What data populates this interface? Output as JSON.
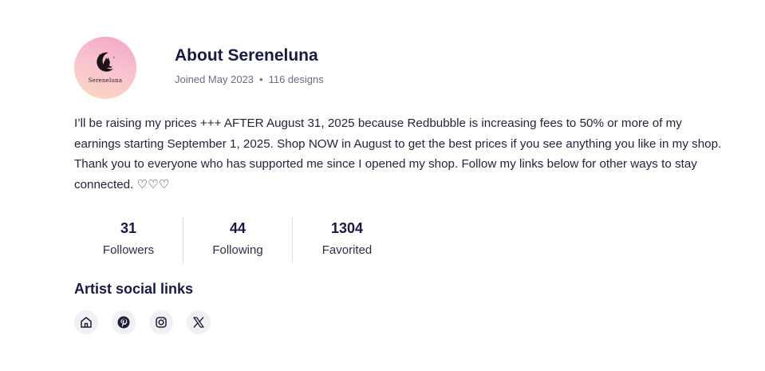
{
  "profile": {
    "avatar_text": "Sereneluna",
    "title": "About Sereneluna",
    "joined": "Joined May 2023",
    "separator": "•",
    "designs": "116 designs",
    "bio": "I’ll be raising my prices +++ AFTER August 31, 2025 because Redbubble is increasing fees to 50% or more of my earnings starting September 1, 2025. Shop NOW in August to get the best prices if you see anything you like in my shop. Thank you to everyone who has supported me since I opened my shop. Follow my links below for other ways to stay connected. ♡♡♡"
  },
  "stats": [
    {
      "value": "31",
      "label": "Followers"
    },
    {
      "value": "44",
      "label": "Following"
    },
    {
      "value": "1304",
      "label": "Favorited"
    }
  ],
  "social": {
    "title": "Artist social links",
    "icons": [
      "home-icon",
      "pinterest-icon",
      "instagram-icon",
      "x-icon"
    ]
  },
  "colors": {
    "heading": "#191a44",
    "text": "#23243f",
    "muted": "#6b6d83",
    "icon_bg": "#f1f1f5"
  }
}
